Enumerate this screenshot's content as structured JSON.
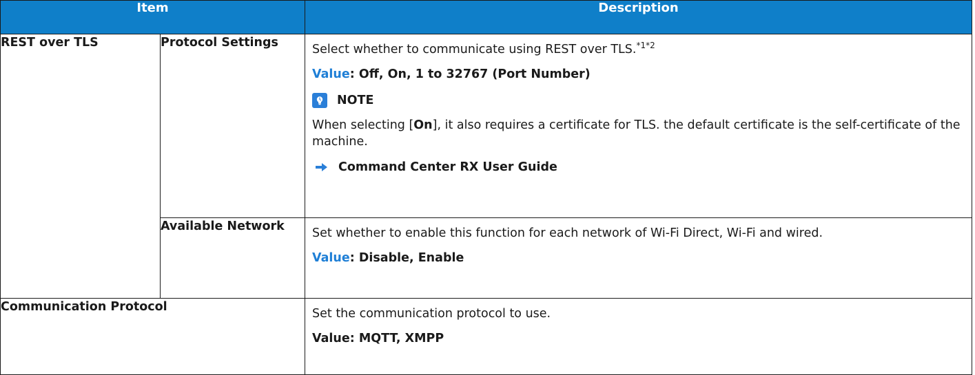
{
  "header": {
    "item": "Item",
    "description": "Description"
  },
  "rest_over_tls": {
    "label": "REST over TLS",
    "protocol_settings": {
      "label": "Protocol Settings",
      "desc_text": "Select whether to communicate using REST over TLS.",
      "desc_sup": "*1*2",
      "value_key": "Value",
      "value_rest": ": Off, On, 1 to 32767 (Port Number)",
      "note_title": "NOTE",
      "note_pre": "When selecting [",
      "note_bold": "On",
      "note_post": "], it also requires a certificate for TLS. the default certificate is the self-certificate of the machine.",
      "link_text": "Command Center RX User Guide",
      "icons": {
        "note": "lightbulb-icon",
        "link": "right-arrow-icon"
      }
    },
    "available_network": {
      "label": "Available Network",
      "desc_text": "Set whether to enable this function for each network of Wi-Fi Direct, Wi-Fi and wired.",
      "value_key": "Value",
      "value_rest": ": Disable, Enable"
    }
  },
  "communication_protocol": {
    "label": "Communication Protocol",
    "desc_text": "Set the communication protocol to use.",
    "value_text": "Value: MQTT, XMPP"
  },
  "colors": {
    "header_bg": "#0f7fc9",
    "value_key": "#1f7fd6",
    "icon_blue": "#2a7fd8"
  }
}
